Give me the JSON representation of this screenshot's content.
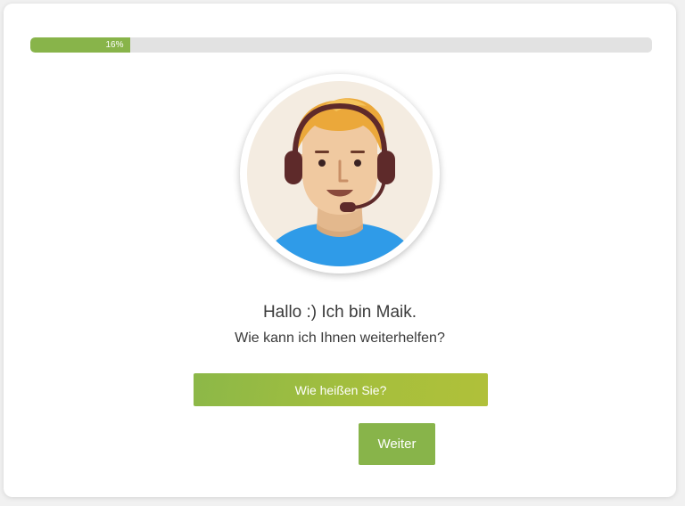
{
  "progress": {
    "percent": 16,
    "label": "16%"
  },
  "agent": {
    "illustration": "support-agent-headset-avatar"
  },
  "message": {
    "greeting": "Hallo :) Ich bin Maik.",
    "question": "Wie kann ich Ihnen weiterhelfen?"
  },
  "actions": {
    "name_button_label": "Wie heißen Sie?",
    "next_button_label": "Weiter"
  },
  "colors": {
    "accent": "#88b44a",
    "track": "#e2e2e2",
    "shirt": "#2f9be8",
    "hair": "#eba83a",
    "skin": "#f0c9a0",
    "headset": "#5e2a2a"
  }
}
